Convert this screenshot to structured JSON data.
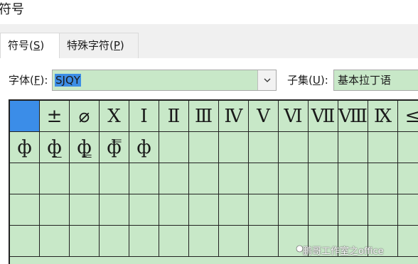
{
  "window": {
    "title": "符号"
  },
  "tabs": [
    {
      "label": "符号(",
      "key": "S",
      "close": ")"
    },
    {
      "label": "特殊字符(",
      "key": "P",
      "close": ")"
    }
  ],
  "font": {
    "label": "字体(",
    "key": "F",
    "close": "):",
    "value": "SJQY"
  },
  "subset": {
    "label": "子集(",
    "key": "U",
    "close": "):",
    "value": "基本拉丁语"
  },
  "symbols": {
    "row1": [
      "",
      "±",
      "⌀",
      "Ⅹ",
      "Ⅰ",
      "Ⅱ",
      "Ⅲ",
      "Ⅳ",
      "Ⅴ",
      "Ⅵ",
      "Ⅶ",
      "Ⅷ",
      "Ⅸ",
      "≤"
    ],
    "row2": [
      "ф",
      "ф̲",
      "ф̳",
      "ф̿",
      "ф",
      "",
      "",
      "",
      "",
      "",
      "",
      "",
      "",
      ""
    ]
  },
  "watermark": {
    "text": "鹏哥工作室之office"
  }
}
